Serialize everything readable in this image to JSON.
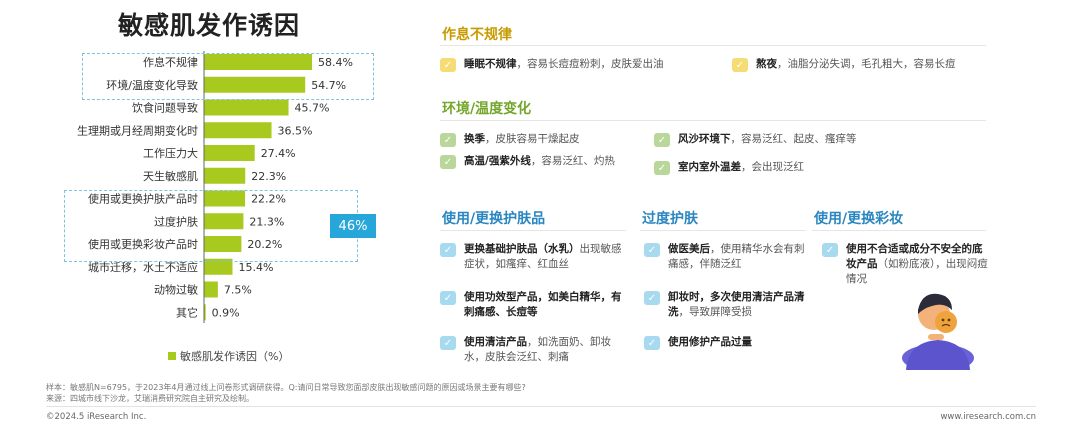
{
  "title": "敏感肌发作诱因",
  "chart_data": {
    "type": "bar",
    "orientation": "horizontal",
    "categories": [
      "作息不规律",
      "环境/温度变化导致",
      "饮食问题导致",
      "生理期或月经周期变化时",
      "工作压力大",
      "天生敏感肌",
      "使用或更换护肤产品时",
      "过度护肤",
      "使用或更换彩妆产品时",
      "城市迁移，水土不适应",
      "动物过敏",
      "其它"
    ],
    "values": [
      58.4,
      54.7,
      45.7,
      36.5,
      27.4,
      22.3,
      22.2,
      21.3,
      20.2,
      15.4,
      7.5,
      0.9
    ],
    "value_labels": [
      "58.4%",
      "54.7%",
      "45.7%",
      "36.5%",
      "27.4%",
      "22.3%",
      "22.2%",
      "21.3%",
      "20.2%",
      "15.4%",
      "7.5%",
      "0.9%"
    ],
    "legend": "敏感肌发作诱因（%）",
    "series_color": "#a8c91e",
    "grid": false
  },
  "badge": "46%",
  "sections": {
    "sleep": {
      "title": "作息不规律",
      "items": [
        {
          "bold": "睡眠不规律",
          "text": "，容易长痘痘粉刺，皮肤爱出油"
        },
        {
          "bold": "熬夜",
          "text": "，油脂分泌失调，毛孔粗大，容易长痘"
        }
      ]
    },
    "env": {
      "title": "环境/温度变化",
      "items": [
        {
          "bold": "换季",
          "text": "，皮肤容易干燥起皮"
        },
        {
          "bold": "风沙环境下",
          "text": "，容易泛红、起皮、瘙痒等"
        },
        {
          "bold": "高温/强紫外线",
          "text": "，容易泛红、灼热"
        },
        {
          "bold": "室内室外温差",
          "text": "，会出现泛红"
        }
      ]
    },
    "skincare": {
      "title": "使用/更换护肤品",
      "items": [
        {
          "bold": "更换基础护肤品（水乳）",
          "text": "出现敏感症状，如瘙痒、红血丝"
        },
        {
          "bold": "使用功效型产品，如美白精华，有刺痛感、长痘等",
          "text": ""
        },
        {
          "bold": "使用清洁产品",
          "text": "，如洗面奶、卸妆水，皮肤会泛红、刺痛"
        }
      ]
    },
    "over": {
      "title": "过度护肤",
      "items": [
        {
          "bold": "做医美后",
          "text": "，使用精华水会有刺痛感，伴随泛红"
        },
        {
          "bold": "卸妆时，多次使用清洁产品清洗",
          "text": "，导致屏障受损"
        },
        {
          "bold": "使用修护产品过量",
          "text": ""
        }
      ]
    },
    "makeup": {
      "title": "使用/更换彩妆",
      "items": [
        {
          "bold": "使用不合适或成分不安全的底妆产品",
          "text": "（如粉底液），出现闷痘情况"
        }
      ]
    }
  },
  "footer": {
    "sample": "样本：敏感肌N=6795，于2023年4月通过线上问卷形式调研获得。Q:请问日常导致您面部皮肤出现敏感问题的原因或场景主要有哪些?",
    "source": "来源：四城市线下沙龙，艾瑞消费研究院自主研究及绘制。",
    "copyright": "©2024.5 iResearch Inc.",
    "website": "www.iresearch.com.cn"
  },
  "colors": {
    "yellow_check": "#f5dc74",
    "green_check": "#b9d69b",
    "blue_check": "#a7d9ef",
    "badge": "#27a6d9"
  },
  "icons": {
    "check": "check-icon",
    "illustration": "sensitive-skin-person-illustration"
  }
}
